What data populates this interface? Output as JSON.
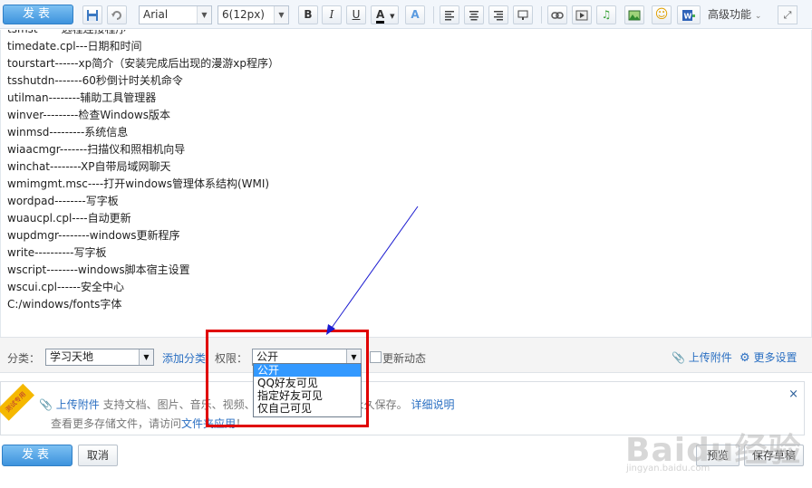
{
  "toolbar": {
    "publish_label": "发表",
    "font_name": "Arial",
    "font_size": "6(12px)",
    "bold": "B",
    "italic": "I",
    "underline": "U",
    "font_color": "A",
    "font_effect": "A",
    "advanced_label": "高级功能"
  },
  "content": {
    "lines": [
      "tsmst------远程连接程序",
      "timedate.cpl---日期和时间",
      "tourstart------xp简介（安装完成后出现的漫游xp程序）",
      "tsshutdn-------60秒倒计时关机命令",
      "utilman--------辅助工具管理器",
      "winver---------检查Windows版本",
      "winmsd---------系统信息",
      "wiaacmgr-------扫描仪和照相机向导",
      "winchat--------XP自带局域网聊天",
      "wmimgmt.msc----打开windows管理体系结构(WMI)",
      "wordpad--------写字板",
      "wuaucpl.cpl----自动更新",
      "wupdmgr--------windows更新程序",
      "write----------写字板",
      "wscript--------windows脚本宿主设置",
      "wscui.cpl------安全中心",
      "C:/windows/fonts字体"
    ]
  },
  "options": {
    "category_label": "分类：",
    "category_value": "学习天地",
    "add_category": "添加分类",
    "permission_label": "权限：",
    "permission_value": "公开",
    "update_feed_label": "更新动态",
    "upload_attachment": "上传附件",
    "more_settings": "更多设置"
  },
  "permission_dropdown": {
    "options": [
      "公开",
      "QQ好友可见",
      "指定好友可见",
      "仅自己可见"
    ]
  },
  "upload_panel": {
    "ribbon": "测试专用",
    "upload_link": "上传附件",
    "desc": "支持文档、图片、音乐、视频、压缩包等文件，文件永久保存。",
    "detail_link": "详细说明",
    "line2_prefix": "查看更多存储文件，请访问",
    "line2_link": "文件夹应用",
    "line2_suffix": "！",
    "close": "×"
  },
  "bottom": {
    "publish_label": "发表",
    "cancel_label": "取消",
    "preview_label": "预览",
    "save_draft_label": "保存草稿"
  },
  "watermark": {
    "main": "Baidu经验",
    "sub": "jingyan.baidu.com"
  }
}
